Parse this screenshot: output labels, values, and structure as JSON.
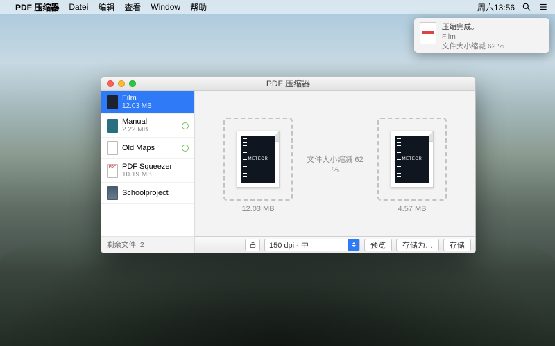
{
  "menubar": {
    "app": "PDF 压缩器",
    "items": [
      "Datei",
      "编辑",
      "查看",
      "Window",
      "帮助"
    ],
    "clock": "周六13:56"
  },
  "notification": {
    "title": "压缩完成。",
    "subtitle": "Film",
    "message": "文件大小缩减 62 %"
  },
  "window": {
    "title": "PDF 压缩器",
    "files": [
      {
        "name": "Film",
        "size": "12.03 MB"
      },
      {
        "name": "Manual",
        "size": "2.22 MB"
      },
      {
        "name": "Old Maps",
        "size": ""
      },
      {
        "name": "PDF Squeezer",
        "size": "10.19 MB"
      },
      {
        "name": "Schoolproject",
        "size": ""
      }
    ],
    "footer": "剩余文件:  2",
    "reduction": "文件大小缩减 62 %",
    "original_label": "12.03 MB",
    "compressed_label": "4.57 MB",
    "doc_text": "METEOR",
    "bottombar": {
      "quality_option": "150 dpi - 中",
      "preview_btn": "预览",
      "saveas_btn": "存储为…",
      "save_btn": "存储"
    }
  }
}
